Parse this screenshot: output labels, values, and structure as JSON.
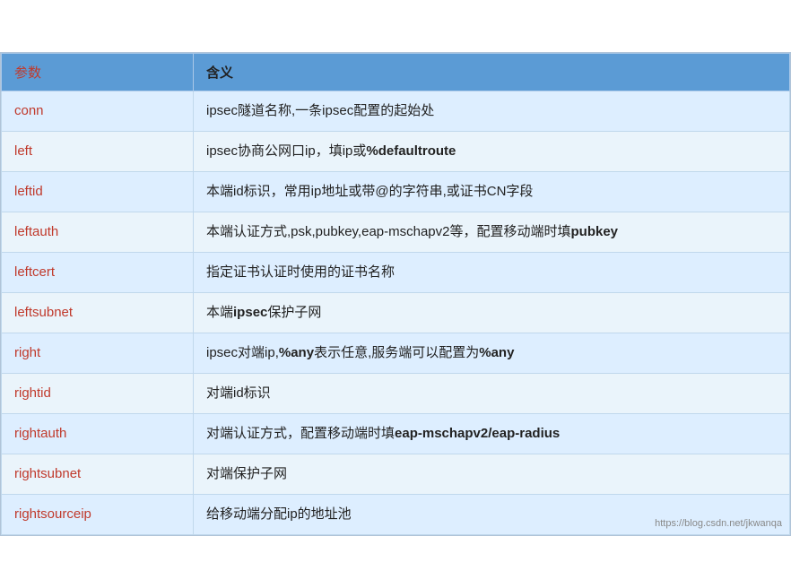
{
  "table": {
    "headers": [
      "参数",
      "含义"
    ],
    "rows": [
      {
        "param": "conn",
        "desc_plain": "ipsec隧道名称,一条ipsec配置的起始处",
        "desc_html": "ipsec隧道名称,一条ipsec配置的起始处"
      },
      {
        "param": "left",
        "desc_plain": "ipsec协商公网口ip，填ip或%defaultroute",
        "desc_html": "ipsec协商公网口ip，填ip或<b>%defaultroute</b>"
      },
      {
        "param": "leftid",
        "desc_plain": "本端id标识，常用ip地址或带@的字符串,或证书CN字段",
        "desc_html": "本端id标识，常用ip地址或带@的字符串,或证书CN字段"
      },
      {
        "param": "leftauth",
        "desc_plain": "本端认证方式,psk,pubkey,eap-mschapv2等，配置移动端时填pubkey",
        "desc_html": "本端认证方式,psk,pubkey,eap-mschapv2等，配置移动端时填<b>pubkey</b>"
      },
      {
        "param": "leftcert",
        "desc_plain": "指定证书认证时使用的证书名称",
        "desc_html": "指定证书认证时使用的证书名称"
      },
      {
        "param": "leftsubnet",
        "desc_plain": "本端ipsec保护子网",
        "desc_html": "本端<b>ipsec</b>保护子网"
      },
      {
        "param": "right",
        "desc_plain": "ipsec对端ip,%any表示任意,服务端可以配置为%any",
        "desc_html": "ipsec对端ip,<b>%any</b>表示任意,服务端可以配置为<b>%any</b>"
      },
      {
        "param": "rightid",
        "desc_plain": "对端id标识",
        "desc_html": "对端id标识"
      },
      {
        "param": "rightauth",
        "desc_plain": "对端认证方式，配置移动端时填eap-mschapv2/eap-radius",
        "desc_html": "对端认证方式，配置移动端时填<b>eap-mschapv2/eap-radius</b>"
      },
      {
        "param": "rightsubnet",
        "desc_plain": "对端保护子网",
        "desc_html": "对端保护子网"
      },
      {
        "param": "rightsourceip",
        "desc_plain": "给移动端分配ip的地址池",
        "desc_html": "给移动端分配ip的地址池"
      }
    ],
    "watermark": "https://blog.csdn.net/jkwanqa"
  }
}
